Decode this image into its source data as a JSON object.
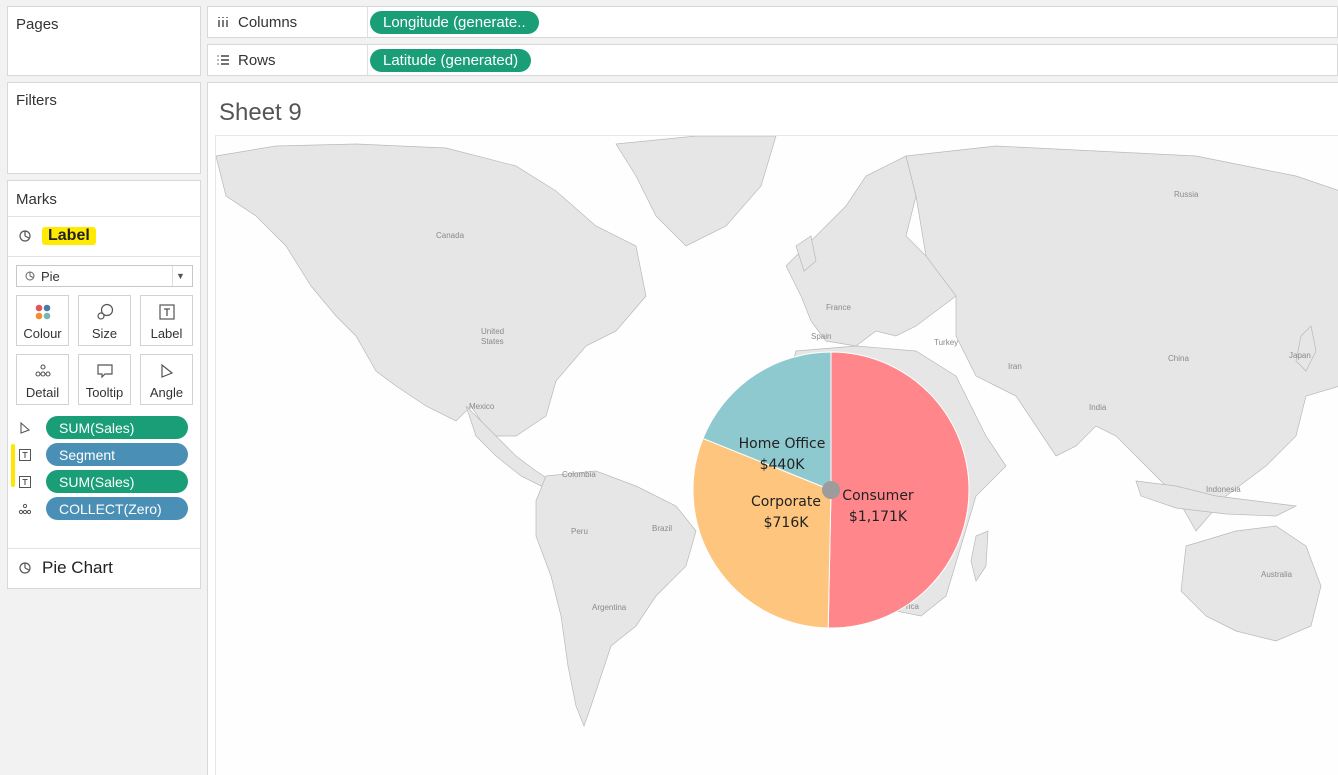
{
  "cards": {
    "pages": "Pages",
    "filters": "Filters",
    "marks": "Marks"
  },
  "marks": {
    "active_layer": "Label",
    "mark_type": "Pie",
    "buttons": {
      "colour": "Colour",
      "size": "Size",
      "label": "Label",
      "detail": "Detail",
      "tooltip": "Tooltip",
      "angle": "Angle"
    },
    "pills": [
      {
        "text": "SUM(Sales)",
        "icon": "angle-icon",
        "color": "#1a9e77"
      },
      {
        "text": "Segment",
        "icon": "label-text-icon",
        "color": "#4a8fb5"
      },
      {
        "text": "SUM(Sales)",
        "icon": "label-text-icon",
        "color": "#1a9e77"
      },
      {
        "text": "COLLECT(Zero)",
        "icon": "detail-icon",
        "color": "#4a8fb5"
      }
    ],
    "second_layer": "Pie Chart"
  },
  "shelves": {
    "columns_label": "Columns",
    "columns_pill": "Longitude (generate..",
    "rows_label": "Rows",
    "rows_pill": "Latitude (generated)"
  },
  "sheet": {
    "title": "Sheet 9"
  },
  "map_labels": {
    "canada": "Canada",
    "united": "United",
    "states": "States",
    "mexico": "Mexico",
    "colombia": "Colombia",
    "peru": "Peru",
    "brazil": "Brazil",
    "argentina": "Argentina",
    "russia": "Russia",
    "france": "France",
    "spain": "Spain",
    "turkey": "Turkey",
    "iran": "Iran",
    "china": "China",
    "japan": "Japan",
    "india": "India",
    "indonesia": "Indonesia",
    "australia": "Australia",
    "africa_partial": "rica"
  },
  "chart_data": {
    "type": "pie",
    "categories": [
      "Consumer",
      "Corporate",
      "Home Office"
    ],
    "values": [
      1171,
      716,
      440
    ],
    "value_labels": [
      "$1,171K",
      "$716K",
      "$440K"
    ],
    "colors": [
      "#ff878b",
      "#fdc57d",
      "#8fc9d0"
    ]
  },
  "colors": {
    "green_pill": "#1a9e77",
    "blue_pill": "#4a8fb5",
    "highlight": "#ffea00",
    "land": "#e6e6e6"
  }
}
